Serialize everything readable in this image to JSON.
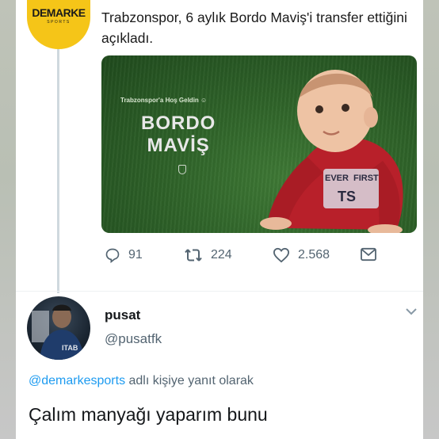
{
  "tweet": {
    "account_logo_main": "DEMARKE",
    "account_logo_sub": "SPORTS",
    "text": "Trabzonspor, 6 aylık Bordo Maviş'i transfer ettiğini açıkladı.",
    "media": {
      "welcome": "Trabzonspor'a Hoş Geldin",
      "headline_line1": "BORDO",
      "headline_line2": "MAVİŞ",
      "shirt_text": [
        "EVER",
        "FIRST",
        "TS"
      ]
    },
    "actions": {
      "replies": "91",
      "retweets": "224",
      "likes": "2.568"
    }
  },
  "reply": {
    "name": "pusat",
    "handle": "@pusatfk",
    "avatar_text": "ITAB",
    "reply_to_mention": "@demarkesports",
    "reply_to_suffix": " adlı kişiye yanıt olarak",
    "text": "Çalım manyağı yaparım bunu"
  },
  "colors": {
    "logo_yellow": "#f5c518",
    "link_blue": "#1d9bf0",
    "secondary_text": "#536471",
    "shirt_red": "#b8202a"
  }
}
